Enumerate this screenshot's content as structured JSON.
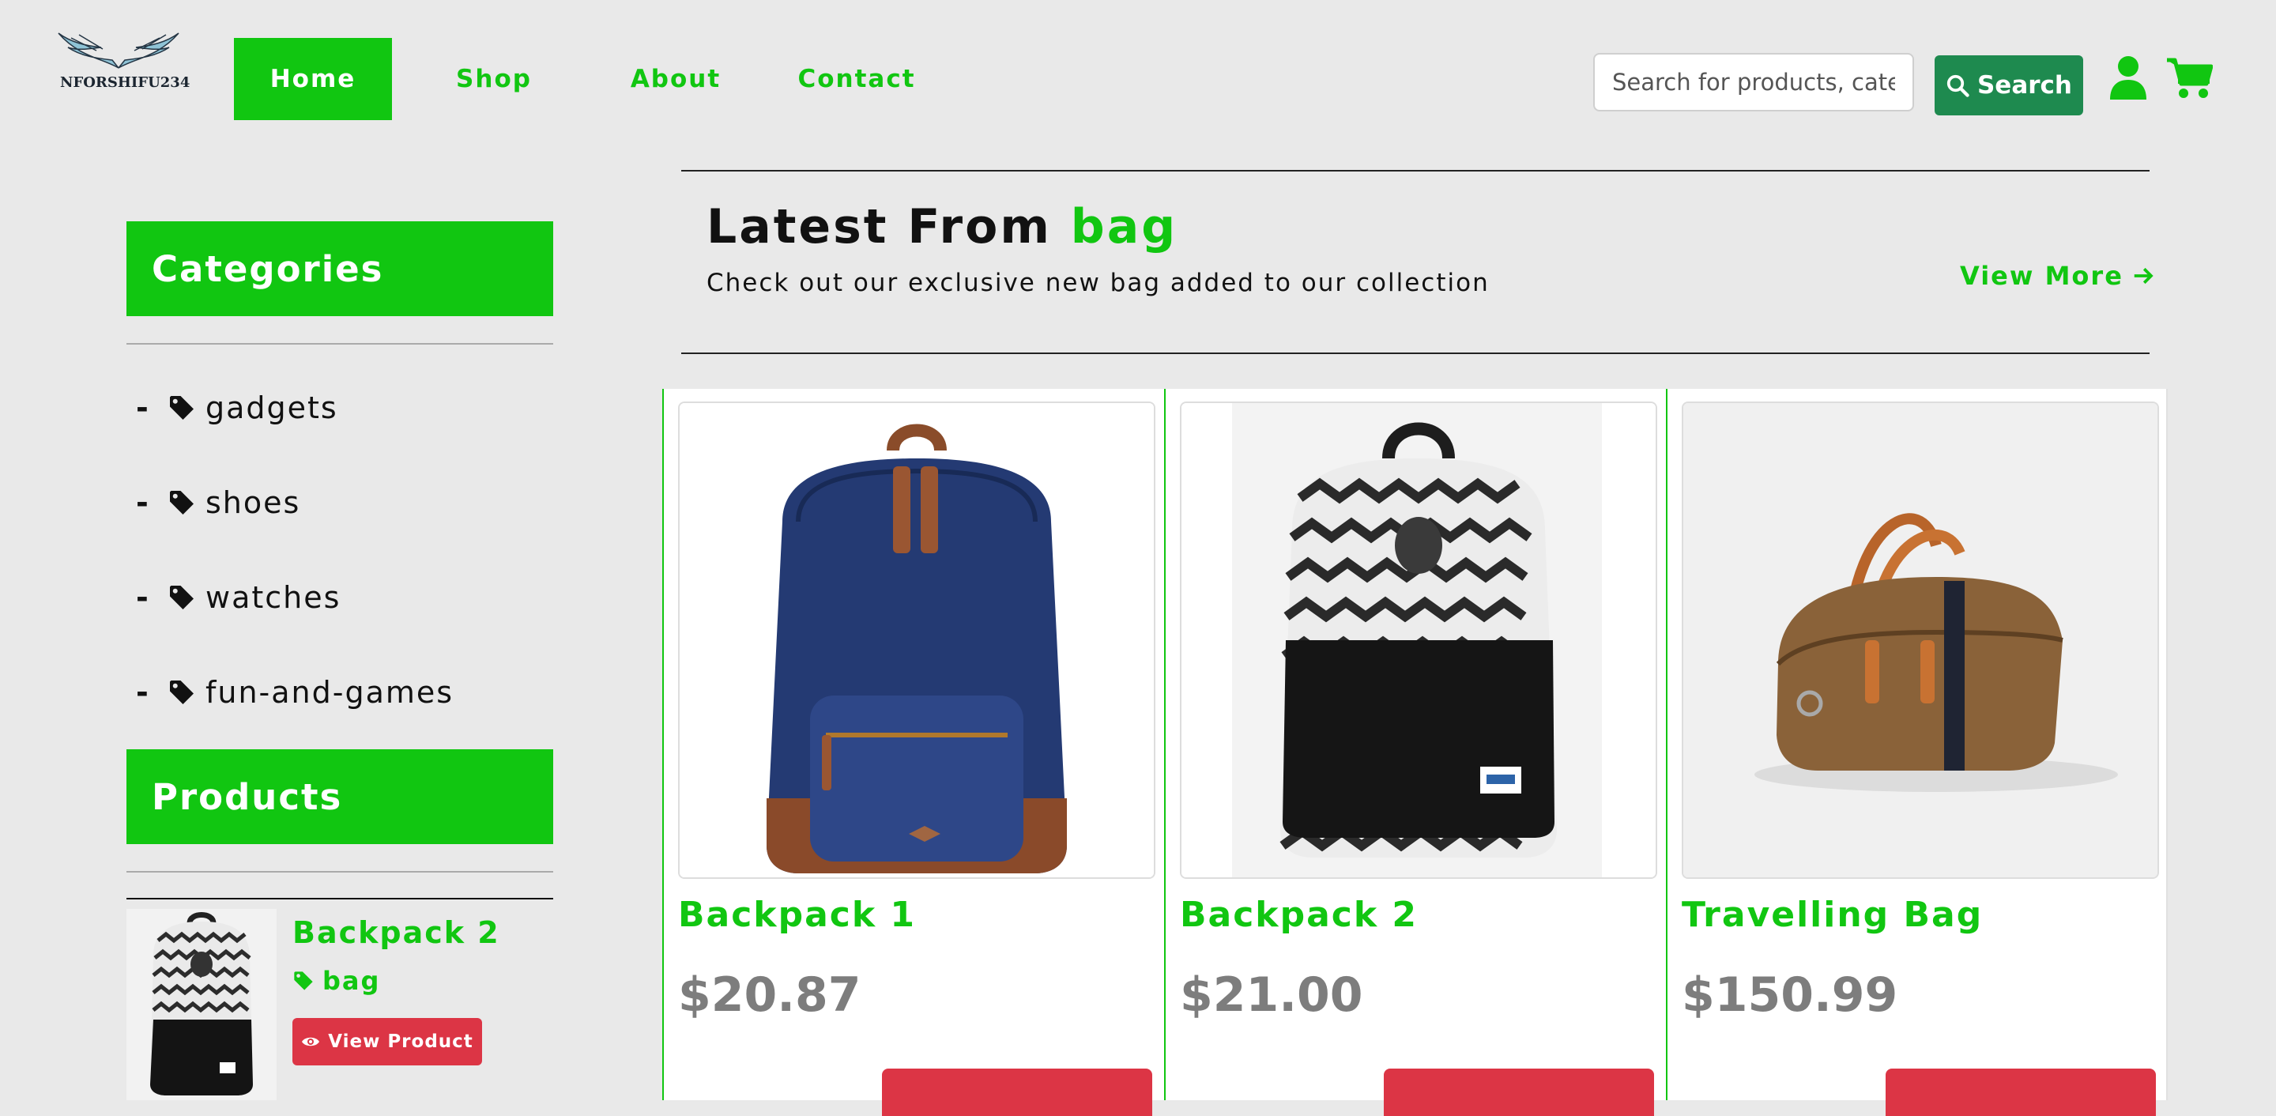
{
  "brand": {
    "logo_text": "NFORSHIFU234"
  },
  "nav": {
    "items": [
      {
        "label": "Home"
      },
      {
        "label": "Shop"
      },
      {
        "label": "About"
      },
      {
        "label": "Contact"
      }
    ],
    "active": "Home"
  },
  "search": {
    "placeholder": "Search for products, categories",
    "button_label": "Search"
  },
  "sidebar": {
    "categories_title": "Categories",
    "categories": [
      {
        "label": "gadgets",
        "icon": "tag-icon"
      },
      {
        "label": "shoes",
        "icon": "tag-icon"
      },
      {
        "label": "watches",
        "icon": "tag-icon"
      },
      {
        "label": "fun-and-games",
        "icon": "tag-icon"
      }
    ],
    "products_title": "Products",
    "product": {
      "title": "Backpack 2",
      "category": "bag",
      "button_label": "View Product",
      "image": "patterned-backpack"
    }
  },
  "main": {
    "heading_prefix": "Latest From",
    "heading_accent": "bag",
    "subheading": "Check out our exclusive new bag added to our collection",
    "view_more_label": "View More",
    "products": [
      {
        "title": "Backpack 1",
        "price": "$20.87",
        "image": "navy-backpack"
      },
      {
        "title": "Backpack 2",
        "price": "$21.00",
        "image": "patterned-backpack"
      },
      {
        "title": "Travelling Bag",
        "price": "$150.99",
        "image": "brown-duffel-bag"
      }
    ]
  },
  "colors": {
    "accent": "#11c611",
    "search_button": "#1e8a4f",
    "action_red": "#dc3545",
    "price_gray": "#7d7d7d",
    "background": "#e9e9e9"
  }
}
